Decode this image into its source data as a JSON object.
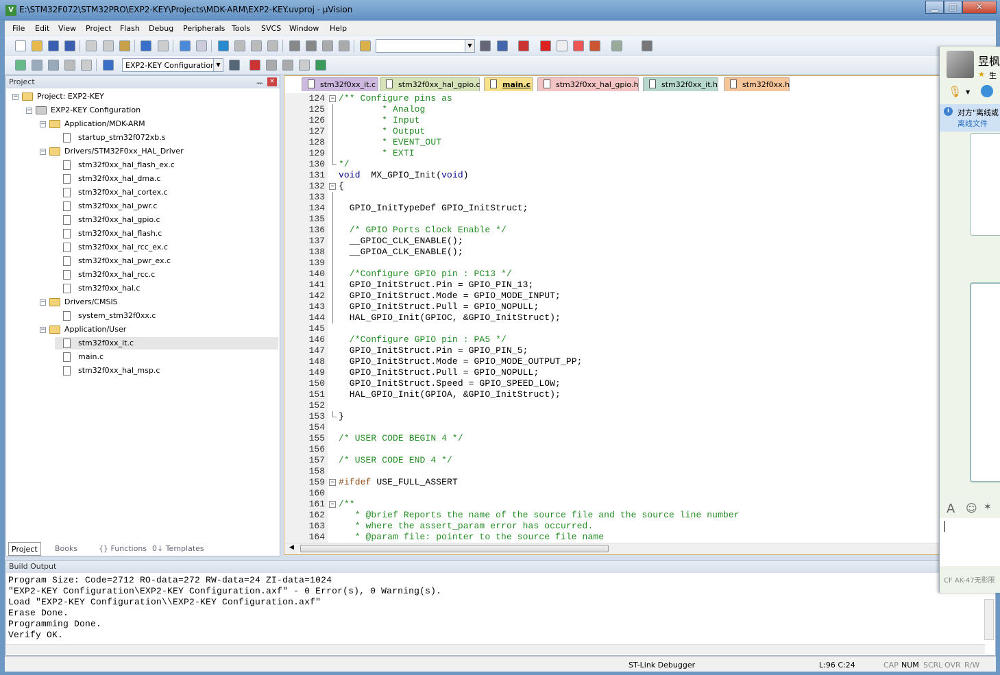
{
  "window": {
    "title": "E:\\STM32F072\\STM32PRO\\EXP2-KEY\\Projects\\MDK-ARM\\EXP2-KEY.uvproj - µVision",
    "icon_text": "V",
    "minimize": "▁",
    "maximize": "□",
    "close": "✕"
  },
  "menu": [
    "File",
    "Edit",
    "View",
    "Project",
    "Flash",
    "Debug",
    "Peripherals",
    "Tools",
    "SVCS",
    "Window",
    "Help"
  ],
  "toolbar": {
    "find_value": "",
    "target_select": "EXP2-KEY Configuration"
  },
  "project_panel": {
    "title": "Project",
    "pin": "ᅲ",
    "close": "✕",
    "tree": [
      {
        "label": "Project: EXP2-KEY",
        "level": 0,
        "type": "project",
        "exp": "−"
      },
      {
        "label": "EXP2-KEY Configuration",
        "level": 1,
        "type": "target",
        "exp": "−"
      },
      {
        "label": "Application/MDK-ARM",
        "level": 2,
        "type": "folder",
        "exp": "−"
      },
      {
        "label": "startup_stm32f072xb.s",
        "level": 3,
        "type": "file"
      },
      {
        "label": "Drivers/STM32F0xx_HAL_Driver",
        "level": 2,
        "type": "folder",
        "exp": "−"
      },
      {
        "label": "stm32f0xx_hal_flash_ex.c",
        "level": 3,
        "type": "file"
      },
      {
        "label": "stm32f0xx_hal_dma.c",
        "level": 3,
        "type": "file"
      },
      {
        "label": "stm32f0xx_hal_cortex.c",
        "level": 3,
        "type": "file"
      },
      {
        "label": "stm32f0xx_hal_pwr.c",
        "level": 3,
        "type": "file"
      },
      {
        "label": "stm32f0xx_hal_gpio.c",
        "level": 3,
        "type": "file"
      },
      {
        "label": "stm32f0xx_hal_flash.c",
        "level": 3,
        "type": "file"
      },
      {
        "label": "stm32f0xx_hal_rcc_ex.c",
        "level": 3,
        "type": "file"
      },
      {
        "label": "stm32f0xx_hal_pwr_ex.c",
        "level": 3,
        "type": "file"
      },
      {
        "label": "stm32f0xx_hal_rcc.c",
        "level": 3,
        "type": "file"
      },
      {
        "label": "stm32f0xx_hal.c",
        "level": 3,
        "type": "file"
      },
      {
        "label": "Drivers/CMSIS",
        "level": 2,
        "type": "folder",
        "exp": "−"
      },
      {
        "label": "system_stm32f0xx.c",
        "level": 3,
        "type": "file"
      },
      {
        "label": "Application/User",
        "level": 2,
        "type": "folder",
        "exp": "−"
      },
      {
        "label": "stm32f0xx_it.c",
        "level": 3,
        "type": "file",
        "selected": true
      },
      {
        "label": "main.c",
        "level": 3,
        "type": "file"
      },
      {
        "label": "stm32f0xx_hal_msp.c",
        "level": 3,
        "type": "file"
      }
    ],
    "tabs": [
      "Project",
      "Books",
      "{} Functions",
      "0↓ Templates"
    ]
  },
  "editor_tabs": [
    {
      "label": "stm32f0xx_it.c",
      "color": "#cdb8e0"
    },
    {
      "label": "stm32f0xx_hal_gpio.c",
      "color": "#d6e2b8"
    },
    {
      "label": "main.c",
      "color": "#f7e08a",
      "active": true
    },
    {
      "label": "stm32f0xx_hal_gpio.h",
      "color": "#f3c4c4"
    },
    {
      "label": "stm32f0xx_it.h",
      "color": "#b7d8cc"
    },
    {
      "label": "stm32f0xx.h",
      "color": "#f6c499"
    }
  ],
  "code": [
    {
      "n": "124",
      "f": "open",
      "s": [
        [
          "c",
          "/** Configure pins as"
        ]
      ]
    },
    {
      "n": "125",
      "s": [
        [
          "c",
          "        * Analog"
        ]
      ]
    },
    {
      "n": "126",
      "s": [
        [
          "c",
          "        * Input"
        ]
      ]
    },
    {
      "n": "127",
      "s": [
        [
          "c",
          "        * Output"
        ]
      ]
    },
    {
      "n": "128",
      "s": [
        [
          "c",
          "        * EVENT_OUT"
        ]
      ]
    },
    {
      "n": "129",
      "s": [
        [
          "c",
          "        * EXTI"
        ]
      ]
    },
    {
      "n": "130",
      "f": "end",
      "s": [
        [
          "c",
          "*/"
        ]
      ]
    },
    {
      "n": "131",
      "s": [
        [
          "k",
          "void"
        ],
        [
          "",
          "  MX_GPIO_Init("
        ],
        [
          "k",
          "void"
        ],
        [
          "",
          ")"
        ]
      ]
    },
    {
      "n": "132",
      "f": "open",
      "s": [
        [
          "",
          "{"
        ]
      ]
    },
    {
      "n": "133",
      "s": []
    },
    {
      "n": "134",
      "s": [
        [
          "",
          "  GPIO_InitTypeDef GPIO_InitStruct;"
        ]
      ]
    },
    {
      "n": "135",
      "s": []
    },
    {
      "n": "136",
      "s": [
        [
          "c",
          "  /* GPIO Ports Clock Enable */"
        ]
      ]
    },
    {
      "n": "137",
      "s": [
        [
          "",
          "  __GPIOC_CLK_ENABLE();"
        ]
      ]
    },
    {
      "n": "138",
      "s": [
        [
          "",
          "  __GPIOA_CLK_ENABLE();"
        ]
      ]
    },
    {
      "n": "139",
      "s": []
    },
    {
      "n": "140",
      "s": [
        [
          "c",
          "  /*Configure GPIO pin : PC13 */"
        ]
      ]
    },
    {
      "n": "141",
      "s": [
        [
          "",
          "  GPIO_InitStruct.Pin = GPIO_PIN_13;"
        ]
      ]
    },
    {
      "n": "142",
      "s": [
        [
          "",
          "  GPIO_InitStruct.Mode = GPIO_MODE_INPUT;"
        ]
      ]
    },
    {
      "n": "143",
      "s": [
        [
          "",
          "  GPIO_InitStruct.Pull = GPIO_NOPULL;"
        ]
      ]
    },
    {
      "n": "144",
      "s": [
        [
          "",
          "  HAL_GPIO_Init(GPIOC, &GPIO_InitStruct);"
        ]
      ]
    },
    {
      "n": "145",
      "s": []
    },
    {
      "n": "146",
      "s": [
        [
          "c",
          "  /*Configure GPIO pin : PA5 */"
        ]
      ]
    },
    {
      "n": "147",
      "s": [
        [
          "",
          "  GPIO_InitStruct.Pin = GPIO_PIN_5;"
        ]
      ]
    },
    {
      "n": "148",
      "s": [
        [
          "",
          "  GPIO_InitStruct.Mode = GPIO_MODE_OUTPUT_PP;"
        ]
      ]
    },
    {
      "n": "149",
      "s": [
        [
          "",
          "  GPIO_InitStruct.Pull = GPIO_NOPULL;"
        ]
      ]
    },
    {
      "n": "150",
      "s": [
        [
          "",
          "  GPIO_InitStruct.Speed = GPIO_SPEED_LOW;"
        ]
      ]
    },
    {
      "n": "151",
      "s": [
        [
          "",
          "  HAL_GPIO_Init(GPIOA, &GPIO_InitStruct);"
        ]
      ]
    },
    {
      "n": "152",
      "s": []
    },
    {
      "n": "153",
      "f": "end",
      "s": [
        [
          "",
          "}"
        ]
      ]
    },
    {
      "n": "154",
      "s": []
    },
    {
      "n": "155",
      "s": [
        [
          "c",
          "/* USER CODE BEGIN 4 */"
        ]
      ]
    },
    {
      "n": "156",
      "s": []
    },
    {
      "n": "157",
      "s": [
        [
          "c",
          "/* USER CODE END 4 */"
        ]
      ]
    },
    {
      "n": "158",
      "s": []
    },
    {
      "n": "159",
      "f": "open",
      "s": [
        [
          "p",
          "#ifdef"
        ],
        [
          "",
          " USE_FULL_ASSERT"
        ]
      ]
    },
    {
      "n": "160",
      "s": []
    },
    {
      "n": "161",
      "f": "open",
      "s": [
        [
          "c",
          "/**"
        ]
      ]
    },
    {
      "n": "162",
      "s": [
        [
          "c",
          "   * @brief Reports the name of the source file and the source line number"
        ]
      ]
    },
    {
      "n": "163",
      "s": [
        [
          "c",
          "   * where the assert_param error has occurred."
        ]
      ]
    },
    {
      "n": "164",
      "s": [
        [
          "c",
          "   * @param file: pointer to the source file name"
        ]
      ]
    }
  ],
  "build_output": {
    "title": "Build Output",
    "lines": [
      "Program Size: Code=2712 RO-data=272 RW-data=24 ZI-data=1024",
      "\"EXP2-KEY Configuration\\EXP2-KEY Configuration.axf\" - 0 Error(s), 0 Warning(s).",
      "Load \"EXP2-KEY Configuration\\\\EXP2-KEY Configuration.axf\"",
      "Erase Done.",
      "Programming Done.",
      "Verify OK."
    ]
  },
  "status": {
    "debugger": "ST-Link Debugger",
    "position": "L:96 C:24",
    "cap": "CAP",
    "num": "NUM",
    "scrl": "SCRL",
    "ovr": "OVR",
    "rw": "R/W"
  },
  "chat": {
    "name": "昱枫",
    "status": "生",
    "notice": "对方\"离线或",
    "offline_file": "离线文件",
    "footer": "CF AK-47无影限"
  }
}
